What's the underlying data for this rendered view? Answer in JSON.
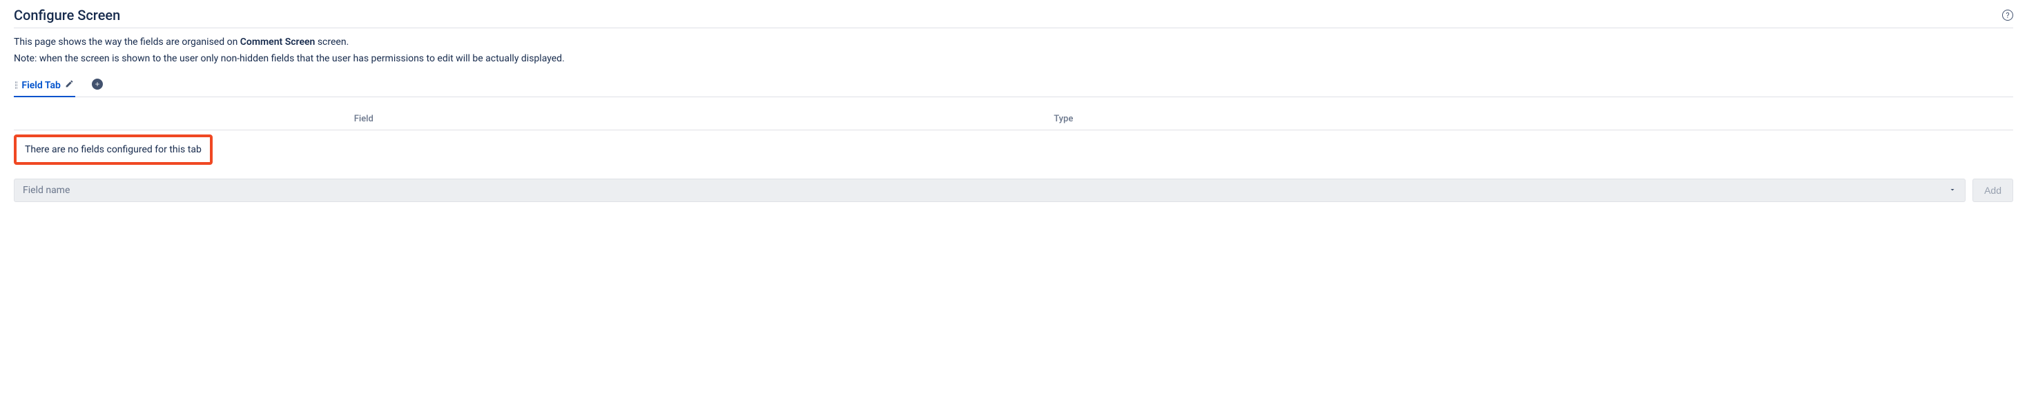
{
  "header": {
    "title": "Configure Screen"
  },
  "description": {
    "intro": "This page shows the way the fields are organised on ",
    "screen_name": "Comment Screen",
    "suffix": " screen."
  },
  "note": "Note: when the screen is shown to the user only non-hidden fields that the user has permissions to edit will be actually displayed.",
  "tabs": {
    "active": "Field Tab"
  },
  "table": {
    "col_field": "Field",
    "col_type": "Type",
    "empty_message": "There are no fields configured for this tab"
  },
  "field_input": {
    "placeholder": "Field name",
    "add_label": "Add"
  }
}
